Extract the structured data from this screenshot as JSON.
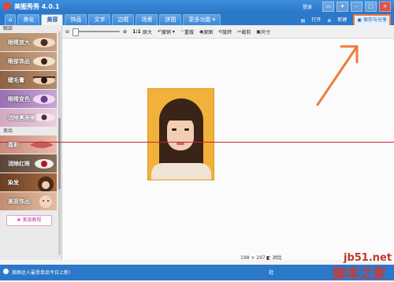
{
  "app": {
    "title": "美图秀秀 4.0.1"
  },
  "titlebar": {
    "login": "登录"
  },
  "nav": {
    "home_icon": "home-icon",
    "tabs": [
      "美化",
      "美容",
      "饰品",
      "文字",
      "边框",
      "场景",
      "拼图",
      "更多功能 ▾"
    ],
    "active_tab": "美容",
    "open": "打开",
    "new": "新建",
    "save_share": "保存与分享"
  },
  "sidebar": {
    "section1": "眼部",
    "section2": "美齿",
    "items1": [
      "眼睛放大",
      "眼部饰品",
      "睫毛膏",
      "眼睛变色",
      "消除黑眼圈"
    ],
    "items2": [
      "唇彩",
      "消除红眼",
      "染发",
      "美容饰品"
    ],
    "guide": "美容教程"
  },
  "toolbar": {
    "ratio": "1:1",
    "original": "原大",
    "undo": "撤销",
    "redo": "重做",
    "original_img": "原图",
    "rotate": "旋转",
    "crop": "裁剪",
    "resize": "尺寸"
  },
  "canvas": {
    "size": "198 × 297",
    "compare": "对比"
  },
  "statusbar": {
    "message": "美图达人最受单品今日上新!",
    "right": "批"
  },
  "watermark": {
    "line1": "jb51.net",
    "line2": "脚本之家"
  }
}
